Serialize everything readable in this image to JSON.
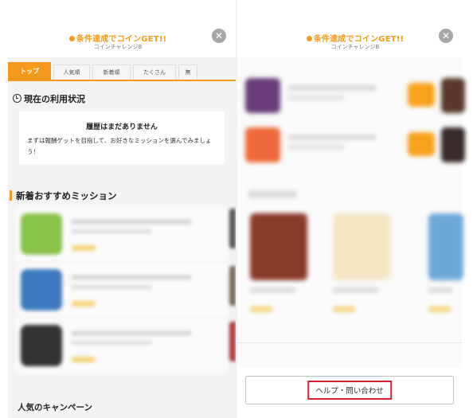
{
  "left_panel": {
    "header": {
      "title": "条件達成でコインGET!!",
      "subtitle": "コインチャレンジB",
      "close_icon": "close-icon"
    },
    "tabs": [
      {
        "label": "トップ",
        "active": true
      },
      {
        "label": "人気順",
        "active": false
      },
      {
        "label": "新着順",
        "active": false
      },
      {
        "label": "たくさん",
        "active": false
      },
      {
        "label": "無",
        "active": false
      }
    ],
    "status": {
      "heading": "現在の利用状況",
      "icon": "clock-icon",
      "card_title": "履歴はまだありません",
      "card_text": "まずは報酬ゲットを目指して、お好きなミッションを選んでみましょう！"
    },
    "missions_heading": "新着おすすめミッション",
    "campaign_heading": "人気のキャンペーン"
  },
  "right_panel": {
    "header": {
      "title": "条件達成でコインGET!!",
      "subtitle": "コインチャレンジB",
      "close_icon": "close-icon"
    },
    "help_button": "ヘルプ・問い合わせ"
  },
  "colors": {
    "accent": "#f39a1d",
    "highlight_border": "#d2202f",
    "close_button": "#a7a7a7"
  }
}
